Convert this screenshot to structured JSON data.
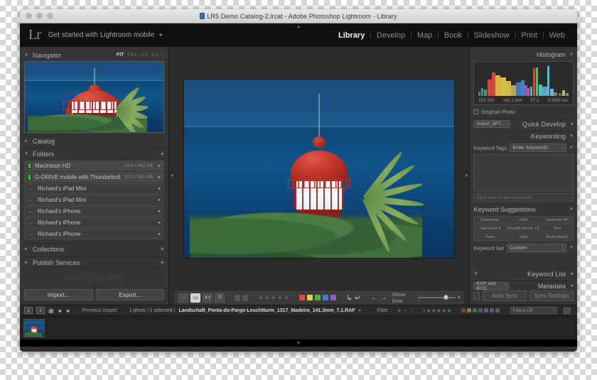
{
  "window": {
    "title": "LR5 Demo Catalog-2.lrcat - Adobe Photoshop Lightroom - Library",
    "doc_icon": "document-icon"
  },
  "identity": {
    "logo": "Lr",
    "text": "Get started with Lightroom mobile",
    "arrow": "►"
  },
  "modules": [
    {
      "label": "Library",
      "active": true
    },
    {
      "label": "Develop",
      "active": false
    },
    {
      "label": "Map",
      "active": false
    },
    {
      "label": "Book",
      "active": false
    },
    {
      "label": "Slideshow",
      "active": false
    },
    {
      "label": "Print",
      "active": false
    },
    {
      "label": "Web",
      "active": false
    }
  ],
  "module_separator": "|",
  "left_panel": {
    "navigator": {
      "title": "Navigator",
      "triangle": "▼",
      "zoom_levels": [
        {
          "label": "FIT",
          "active": true
        },
        {
          "label": "FILL",
          "active": false
        },
        {
          "label": "1:1",
          "active": false
        },
        {
          "label": "3:1",
          "active": false
        }
      ],
      "stepper": "↕"
    },
    "catalog": {
      "title": "Catalog",
      "triangle": "►"
    },
    "folders": {
      "title": "Folders",
      "triangle": "▼",
      "add": "+",
      "items": [
        {
          "name": "Macintosh HD",
          "size": "24.6 / 465 GB",
          "type": "volume",
          "selected": true
        },
        {
          "name": "G-DRIVE mobile with Thunderbolt",
          "size": "20.9 / 931 GB",
          "type": "volume",
          "selected": true
        },
        {
          "name": "Richard's iPad Mini",
          "size": "",
          "type": "device",
          "selected": false
        },
        {
          "name": "Richard's iPad Mini",
          "size": "",
          "type": "device",
          "selected": false
        },
        {
          "name": "Richard's iPhone",
          "size": "",
          "type": "device",
          "selected": false
        },
        {
          "name": "Richard's iPhone",
          "size": "",
          "type": "device",
          "selected": false
        },
        {
          "name": "Richard's iPhone",
          "size": "",
          "type": "device",
          "selected": false
        }
      ]
    },
    "collections": {
      "title": "Collections",
      "triangle": "►",
      "add": "+"
    },
    "publish_services": {
      "title": "Publish Services",
      "triangle": "►",
      "add": "+"
    },
    "watermark": "Lightroom",
    "import_button": "Import...",
    "export_button": "Export..."
  },
  "right_panel": {
    "histogram": {
      "title": "Histogram",
      "triangle": "▼",
      "exif": {
        "iso": "ISO 200",
        "focal_length": "141.1 mm",
        "aperture": "f/7.1",
        "shutter": "1/1000 sec"
      }
    },
    "original_photo_label": "Original Photo",
    "quick_develop": {
      "title": "Quick Develop",
      "triangle": "◄",
      "preset": "Import_DFT..."
    },
    "keywording": {
      "title": "Keywording",
      "triangle": "▼",
      "tags_label": "Keyword Tags",
      "tags_value": "Enter Keywords",
      "add_hint": "Click here to add keywords"
    },
    "keyword_suggestions": {
      "title": "Keyword Suggestions",
      "triangle": "▼",
      "items": [
        "Panoramic",
        "USA",
        "Yosemite NP",
        "Lightroom 4",
        "Kumbh-Sector 12",
        "Test",
        "Paris",
        "India",
        "Blurb Book2"
      ],
      "set_label": "Keyword Set",
      "set_value": "Custom"
    },
    "keyword_list": {
      "title": "Keyword List",
      "triangle": "◄",
      "add": "+"
    },
    "metadata": {
      "title": "Metadata",
      "triangle": "◄",
      "preset": "EXIF and IPTC"
    },
    "auto_sync_button": "Auto Sync",
    "sync_settings_button": "Sync Settings"
  },
  "toolbar": {
    "view_modes": [
      {
        "name": "grid-view-icon",
        "glyph": "∷",
        "active": false
      },
      {
        "name": "loupe-view-icon",
        "glyph": "▭",
        "active": true
      },
      {
        "name": "compare-view-icon",
        "glyph": "XY",
        "active": false
      },
      {
        "name": "survey-view-icon",
        "glyph": "⌸",
        "active": false
      }
    ],
    "flags": [
      "flag-pick-icon",
      "flag-reject-icon"
    ],
    "stars": "★★★★★",
    "color_labels": [
      "#e04b43",
      "#e3d03c",
      "#55b04c",
      "#3f7fd0",
      "#9a59c8"
    ],
    "rotate_left": "↳",
    "rotate_right": "↵",
    "nav_prev": "←",
    "nav_next": "→",
    "slider_label": "Show Grid",
    "caret": "▾"
  },
  "filmstrip_bar": {
    "screen1": "1",
    "screen2": "2",
    "grid_icon": "grid-icon",
    "back_arrow": "◄",
    "forward_arrow": "►",
    "source": "Previous Import",
    "count": "1 photo / 1 selected /",
    "filename": "Landschaft_Ponta-do-Pargo-Leuchtturm_1317_Madeira_141,3mm_7,1.RAF",
    "file_caret": "▾",
    "filter_label": "Filter :",
    "filter_stars": "★★★★★",
    "filter_compare": "≥",
    "filters_off": "Filters Off",
    "color_chips": [
      "#c0564e",
      "#c9bb55",
      "#6aa361",
      "#5a85bc",
      "#9a7ec0",
      "#8a8a8a",
      "#8a8a8a"
    ]
  },
  "colors": {
    "panel_bg": "#353535",
    "work_bg": "#2c2c2c",
    "accent_red": "#c03529",
    "sea_blue": "#10548c"
  }
}
